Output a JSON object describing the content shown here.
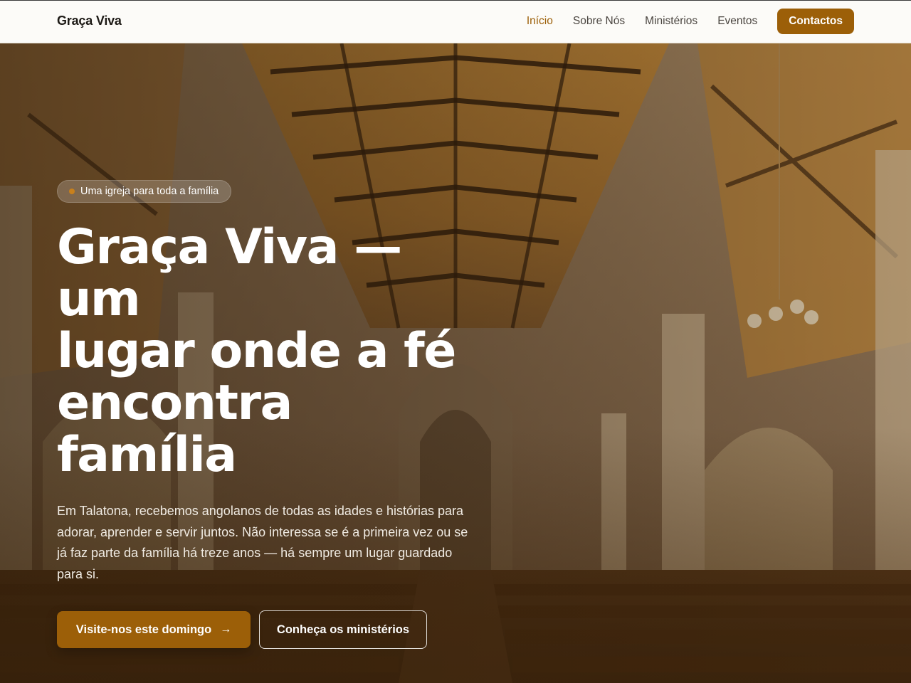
{
  "header": {
    "brand": "Graça Viva",
    "nav": [
      {
        "label": "Início",
        "active": true
      },
      {
        "label": "Sobre Nós",
        "active": false
      },
      {
        "label": "Ministérios",
        "active": false
      },
      {
        "label": "Eventos",
        "active": false
      }
    ],
    "cta_label": "Contactos"
  },
  "hero": {
    "badge": "Uma igreja para toda a família",
    "title_lines": [
      "Graça Viva — um",
      "lugar onde a fé",
      "encontra família"
    ],
    "description": "Em Talatona, recebemos angolanos de todas as idades e histórias para adorar, aprender e servir juntos. Não interessa se é a primeira vez ou se já faz parte da família há treze anos — há sempre um lugar guardado para si.",
    "primary_button": "Visite-nos este domingo",
    "primary_button_icon": "arrow-right-icon",
    "secondary_button": "Conheça os ministérios",
    "background_image": "church-nave-interior-photo"
  },
  "colors": {
    "accent": "#9c5f08",
    "badge_dot": "#c8801c",
    "nav_bg": "#fcfbf8",
    "text_dark": "#1d1a16"
  }
}
